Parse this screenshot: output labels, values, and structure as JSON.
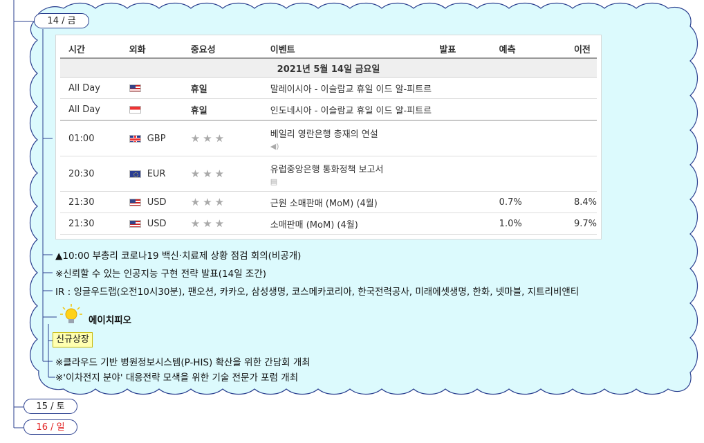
{
  "nodes": {
    "day14": "14 / 금",
    "day15": "15 / 토",
    "day16": "16 / 일"
  },
  "calendar": {
    "headers": [
      "시간",
      "외화",
      "중요성",
      "이벤트",
      "발표",
      "예측",
      "이전"
    ],
    "date_label": "2021년 5월 14일 금요일",
    "holiday_rows": [
      {
        "time": "All Day",
        "flag": "malaysia-flag",
        "importance": "휴일",
        "event": "말레이시아 - 이슬람교 휴일 이드 알-피트르"
      },
      {
        "time": "All Day",
        "flag": "indonesia-flag",
        "importance": "휴일",
        "event": "인도네시아 - 이슬람교 휴일 이드 알-피트르"
      }
    ],
    "rows": [
      {
        "time": "01:00",
        "flag": "uk-flag",
        "currency": "GBP",
        "stars": "★★★",
        "event": "베일리 영란은행 총재의 연설",
        "icon": "speaker-icon",
        "actual": "",
        "forecast": "",
        "previous": ""
      },
      {
        "time": "20:30",
        "flag": "eu-flag",
        "currency": "EUR",
        "stars": "★★★",
        "event": "유럽중앙은행 통화정책 보고서",
        "icon": "document-icon",
        "actual": "",
        "forecast": "",
        "previous": ""
      },
      {
        "time": "21:30",
        "flag": "us-flag",
        "currency": "USD",
        "stars": "★★★",
        "event": "근원 소매판매 (MoM) (4월)",
        "icon": "",
        "actual": "",
        "forecast": "0.7%",
        "previous": "8.4%"
      },
      {
        "time": "21:30",
        "flag": "us-flag",
        "currency": "USD",
        "stars": "★★★",
        "event": "소매판매 (MoM) (4월)",
        "icon": "",
        "actual": "",
        "forecast": "1.0%",
        "previous": "9.7%"
      }
    ]
  },
  "notes": {
    "item1": "▲10:00 부총리 코로나19 백신·치료제 상황 점검 회의(비공개)",
    "item2": "※신뢰할 수 있는 인공지능 구현 전략 발표(14일 조간)",
    "item3": "IR : 잉글우드랩(오전10시30분), 팬오션, 카카오, 삼성생명, 코스메카코리아, 한국전력공사, 미래에셋생명, 한화, 넷마블, 지트리비앤티",
    "hph_label": "에이치피오",
    "badge": "신규상장",
    "item5": "※클라우드 기반 병원정보시스템(P-HIS) 확산을 위한 간담회 개최",
    "item6": "※'이차전지 분야' 대응전략 모색을 위한 기술 전문가 포럼 개최"
  },
  "colors": {
    "cloud_fill": "#dcfafd",
    "cloud_stroke": "#2a3f8f",
    "day16_text": "#e02020",
    "badge_fill": "#ffffb0"
  }
}
